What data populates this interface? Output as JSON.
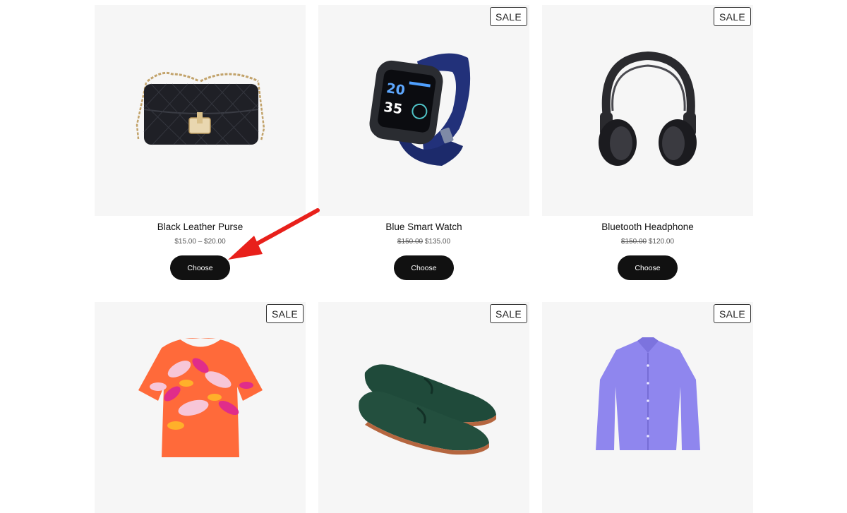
{
  "products": [
    {
      "title": "Black Leather Purse",
      "price_range": "$15.00 – $20.00",
      "sale": false,
      "button": "Choose",
      "image": "black-purse-image"
    },
    {
      "title": "Blue Smart Watch",
      "old_price": "$150.00",
      "new_price": "$135.00",
      "sale": true,
      "sale_label": "SALE",
      "button": "Choose",
      "image": "blue-smartwatch-image",
      "watch_screen": {
        "top": "20",
        "bottom": "35"
      }
    },
    {
      "title": "Bluetooth Headphone",
      "old_price": "$150.00",
      "new_price": "$120.00",
      "sale": true,
      "sale_label": "SALE",
      "button": "Choose",
      "image": "black-headphone-image"
    },
    {
      "sale": true,
      "sale_label": "SALE",
      "image": "patterned-blouse-image"
    },
    {
      "sale": true,
      "sale_label": "SALE",
      "image": "green-loafers-image"
    },
    {
      "sale": true,
      "sale_label": "SALE",
      "image": "purple-shirt-image"
    }
  ],
  "annotation": {
    "type": "red-arrow",
    "color": "#e8201b",
    "points_to": "choose-button"
  }
}
